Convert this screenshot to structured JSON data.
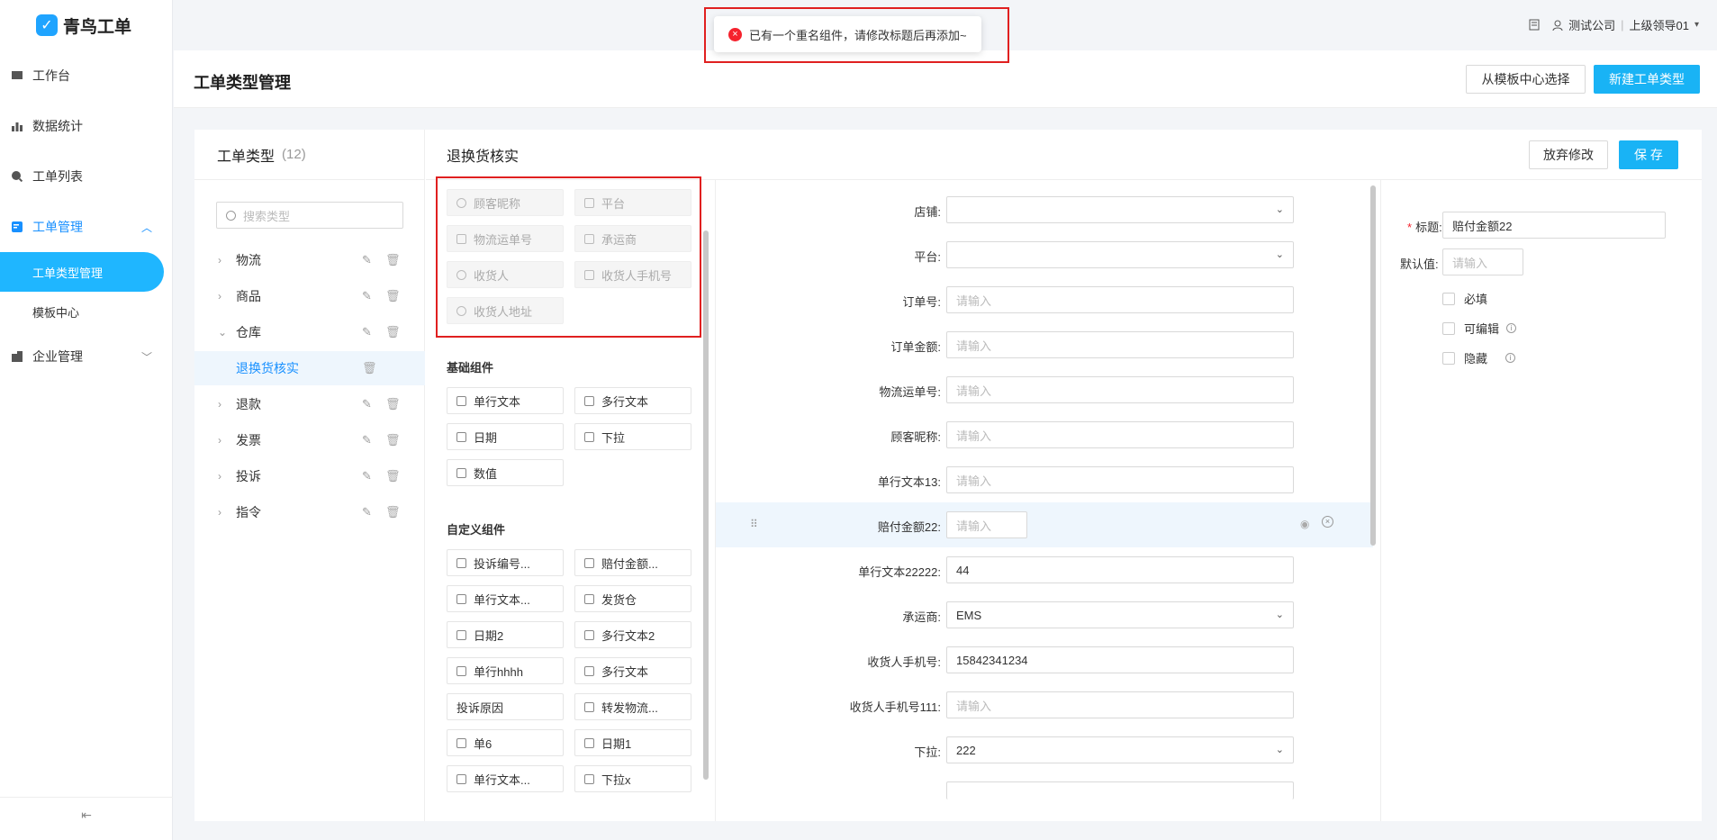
{
  "app": {
    "name": "青鸟工单"
  },
  "sidebar": {
    "items": [
      {
        "label": "工作台",
        "icon": "monitor-icon"
      },
      {
        "label": "数据统计",
        "icon": "bar-chart-icon"
      },
      {
        "label": "工单列表",
        "icon": "search-icon"
      },
      {
        "label": "工单管理",
        "icon": "ticket-icon",
        "expanded": true,
        "children": [
          {
            "label": "工单类型管理",
            "active": true
          },
          {
            "label": "模板中心"
          }
        ]
      },
      {
        "label": "企业管理",
        "icon": "building-icon"
      }
    ],
    "collapse_icon": "collapse-icon"
  },
  "topbar": {
    "company": "测试公司",
    "user": "上级领导01"
  },
  "toast": {
    "message": "已有一个重名组件，请修改标题后再添加~",
    "color": "#f5222d"
  },
  "header": {
    "title": "工单类型管理",
    "template_btn": "从模板中心选择",
    "new_btn": "新建工单类型",
    "accent": "#19b3f5"
  },
  "types": {
    "title": "工单类型",
    "count": "(12)",
    "search_placeholder": "搜索类型",
    "items": [
      {
        "label": "物流"
      },
      {
        "label": "商品"
      },
      {
        "label": "仓库",
        "expanded": true
      },
      {
        "label": "退换货核实",
        "child": true,
        "active": true
      },
      {
        "label": "退款"
      },
      {
        "label": "发票"
      },
      {
        "label": "投诉"
      },
      {
        "label": "指令"
      }
    ]
  },
  "palette": {
    "title": "退换货核实",
    "system_components": [
      "顾客昵称",
      "平台",
      "物流运单号",
      "承运商",
      "收货人",
      "收货人手机号",
      "收货人地址"
    ],
    "basic_title": "基础组件",
    "basic_components": [
      "单行文本",
      "多行文本",
      "日期",
      "下拉",
      "数值"
    ],
    "custom_title": "自定义组件",
    "custom_components": [
      "投诉编号...",
      "赔付金额...",
      "单行文本...",
      "发货仓",
      "日期2",
      "多行文本2",
      "单行hhhh",
      "多行文本",
      "投诉原因",
      "转发物流...",
      "单6",
      "日期1",
      "单行文本...",
      "下拉x"
    ]
  },
  "form": {
    "discard_btn": "放弃修改",
    "save_btn": "保 存",
    "fields": [
      {
        "label": "店铺:",
        "value": "",
        "type": "select"
      },
      {
        "label": "平台:",
        "value": "",
        "type": "select"
      },
      {
        "label": "订单号:",
        "placeholder": "请输入"
      },
      {
        "label": "订单金额:",
        "placeholder": "请输入"
      },
      {
        "label": "物流运单号:",
        "placeholder": "请输入"
      },
      {
        "label": "顾客昵称:",
        "placeholder": "请输入"
      },
      {
        "label": "单行文本13:",
        "placeholder": "请输入"
      },
      {
        "label": "赔付金额22:",
        "placeholder": "请输入",
        "selected": true
      },
      {
        "label": "单行文本22222:",
        "value": "44"
      },
      {
        "label": "承运商:",
        "value": "EMS",
        "type": "select"
      },
      {
        "label": "收货人手机号:",
        "value": "15842341234"
      },
      {
        "label": "收货人手机号111:",
        "placeholder": "请输入"
      },
      {
        "label": "下拉:",
        "value": "222",
        "type": "select"
      }
    ]
  },
  "props": {
    "title_label": "标题:",
    "title_value": "赔付金额22",
    "default_label": "默认值:",
    "default_placeholder": "请输入",
    "checks": [
      {
        "label": "必填"
      },
      {
        "label": "可编辑",
        "info": true
      },
      {
        "label": "隐藏",
        "info": true
      }
    ]
  }
}
